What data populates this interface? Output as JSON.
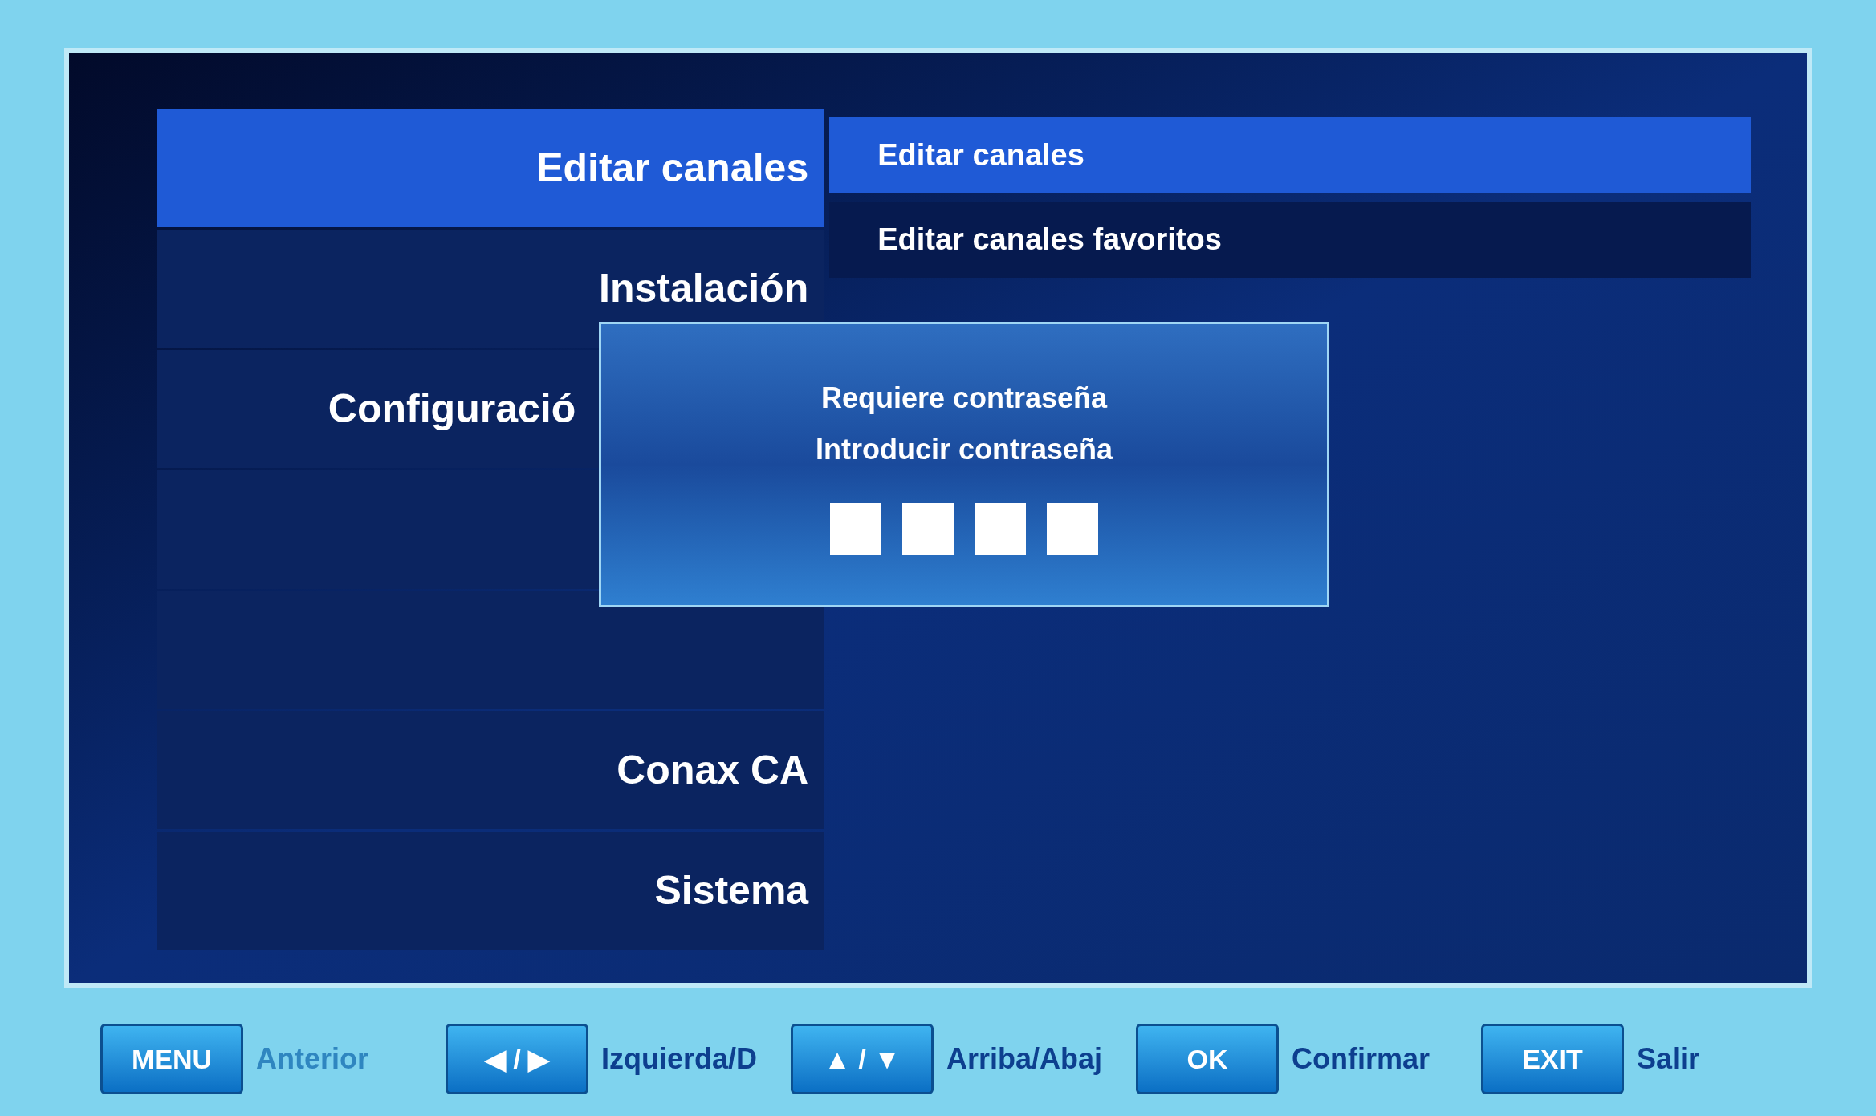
{
  "menu": {
    "items": [
      {
        "label": "Editar canales",
        "selected": true,
        "kind": "full"
      },
      {
        "label": "Instalación",
        "selected": false,
        "kind": "full"
      },
      {
        "label": "Configuració",
        "selected": false,
        "kind": "cut"
      },
      {
        "selected": false,
        "kind": "blank"
      },
      {
        "selected": false,
        "kind": "blank"
      },
      {
        "label": "Conax CA",
        "selected": false,
        "kind": "full"
      },
      {
        "label": "Sistema",
        "selected": false,
        "kind": "full"
      }
    ]
  },
  "submenu": {
    "items": [
      {
        "label": "Editar canales",
        "selected": true
      },
      {
        "label": "Editar canales favoritos",
        "selected": false
      }
    ]
  },
  "dialog": {
    "title": "Requiere contraseña",
    "prompt": "Introducir contraseña"
  },
  "help_bar": [
    {
      "key": "MENU",
      "label": "Anterior",
      "dimmed": true
    },
    {
      "key": "◀ / ▶",
      "label": "Izquierda/D",
      "dimmed": false
    },
    {
      "key": "▲ / ▼",
      "label": "Arriba/Abaj",
      "dimmed": false
    },
    {
      "key": "OK",
      "label": "Confirmar",
      "dimmed": false
    },
    {
      "key": "EXIT",
      "label": "Salir",
      "dimmed": false
    }
  ]
}
